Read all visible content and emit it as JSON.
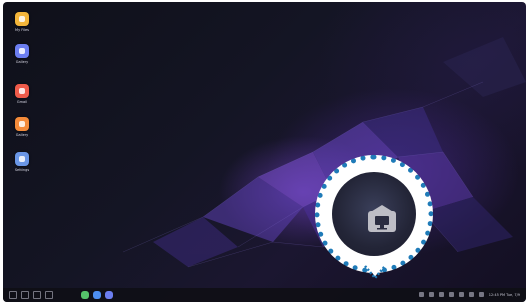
{
  "desktop": {
    "icons": [
      {
        "label": "My Files",
        "color": "#f4b63a"
      },
      {
        "label": "Gallery",
        "color": "#6c7ef0"
      },
      {
        "label": "Gmail",
        "color": "#ef5b4a"
      },
      {
        "label": "Gallery",
        "color": "#f48b3a"
      },
      {
        "label": "Settings",
        "color": "#6a96e6"
      }
    ]
  },
  "taskbar": {
    "apps": [
      {
        "color": "#55c26b"
      },
      {
        "color": "#4d8ef0"
      },
      {
        "color": "#6c7ef0"
      }
    ],
    "clock": "12:45 PM  Tue, 7/9"
  },
  "callout": {
    "border_color": "#1f7bb8",
    "icon": "dex-mode-icon"
  }
}
